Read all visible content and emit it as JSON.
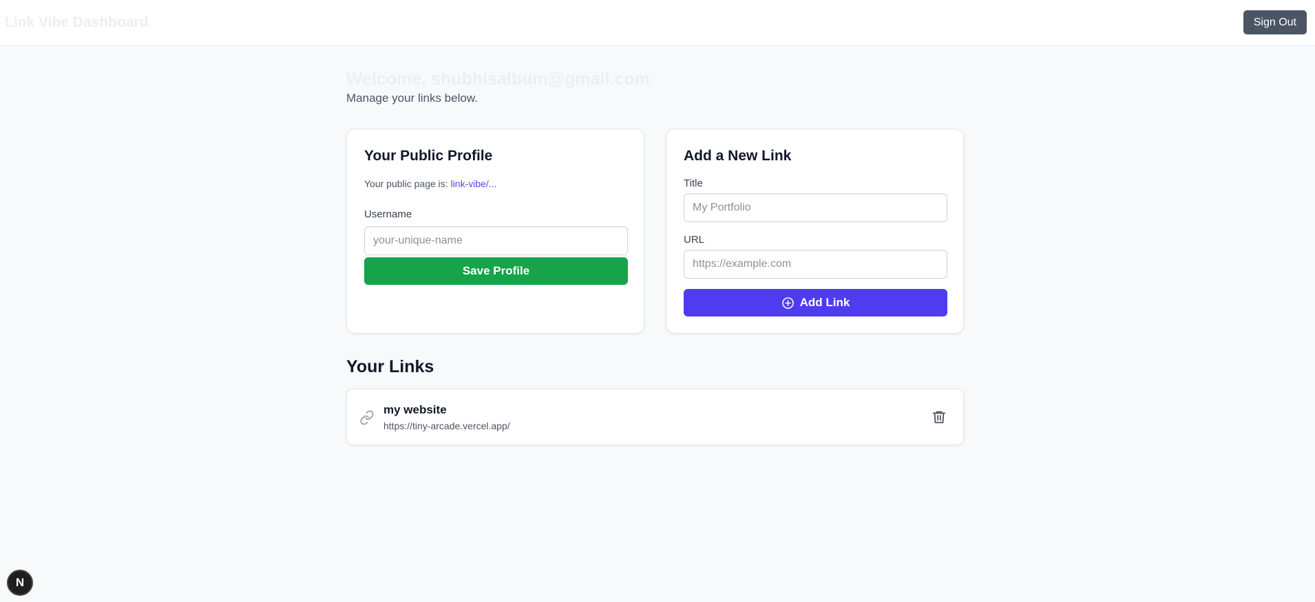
{
  "header": {
    "app_title": "Link Vibe Dashboard",
    "sign_out_label": "Sign Out"
  },
  "welcome": {
    "heading": "Welcome, shubhisalbum@gmail.com",
    "subtitle": "Manage your links below."
  },
  "profile_card": {
    "title": "Your Public Profile",
    "public_page_prefix": "Your public page is: ",
    "public_page_link": "link-vibe/...",
    "username_label": "Username",
    "username_placeholder": "your-unique-name",
    "username_value": "",
    "save_label": "Save Profile"
  },
  "add_link_card": {
    "title": "Add a New Link",
    "title_label": "Title",
    "title_placeholder": "My Portfolio",
    "title_value": "",
    "url_label": "URL",
    "url_placeholder": "https://example.com",
    "url_value": "",
    "add_label": "Add Link",
    "add_icon": "plus-circle-icon"
  },
  "links_section": {
    "heading": "Your Links",
    "items": [
      {
        "title": "my website",
        "url": "https://tiny-arcade.vercel.app/",
        "icon": "link-icon",
        "action_icon": "trash-icon"
      }
    ]
  },
  "dev_badge": {
    "letter": "N"
  },
  "colors": {
    "save_button": "#16a34a",
    "add_button": "#4f3bf0",
    "sign_out_button": "#4b5563",
    "link_accent": "#4f46e5"
  }
}
